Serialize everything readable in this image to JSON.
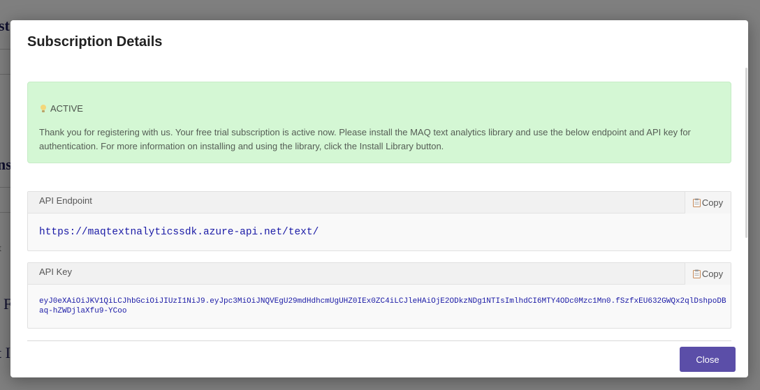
{
  "background": {
    "fragments": [
      "st",
      "ns",
      "t",
      "F",
      "t I"
    ]
  },
  "modal": {
    "title": "Subscription Details",
    "alert": {
      "status": "ACTIVE",
      "status_icon": "lightbulb-icon",
      "message": "Thank you for registering with us. Your free trial subscription is active now. Please install the MAQ text analytics library and use the below endpoint and API key for authentication. For more information on installing and using the library, click the Install Library button.",
      "bg_color": "#d4f7d4"
    },
    "endpoint": {
      "label": "API Endpoint",
      "copy_label": "Copy",
      "value": "https://maqtextnalyticssdk.azure-api.net/text/"
    },
    "api_key": {
      "label": "API Key",
      "copy_label": "Copy",
      "value": "eyJ0eXAiOiJKV1QiLCJhbGciOiJIUzI1NiJ9.eyJpc3MiOiJNQVEgU29mdHdhcmUgUHZ0IEx0ZC4iLCJleHAiOjE2ODkzNDg1NTIsImlhdCI6MTY4ODc0Mzc1Mn0.fSzfxEU632GWQx2qlDshpoDBaq-hZWDjlaXfu9-YCoo"
    },
    "close_label": "Close",
    "accent_color": "#5b4ea8"
  }
}
